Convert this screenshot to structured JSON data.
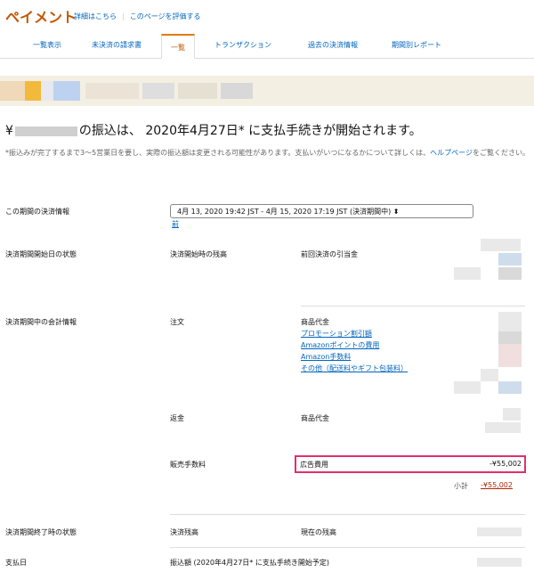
{
  "header": {
    "title": "ペイメント",
    "details_link": "詳細はこちら",
    "rate_link": "このページを評価する"
  },
  "tabs": [
    {
      "label": "一覧表示"
    },
    {
      "label": "未決済の請求書"
    },
    {
      "label": "一覧"
    },
    {
      "label": "トランザクション"
    },
    {
      "label": "過去の決済情報"
    },
    {
      "label": "期間別レポート"
    }
  ],
  "headline": {
    "prefix": "¥",
    "middle": "の振込は、 2020年4月27日* に支払手続きが開始されます。"
  },
  "note": {
    "text": "*振込みが完了するまで3〜5営業日を要し、実際の振込額は変更される可能性があります。支払いがいつになるかについて詳しくは、",
    "link": "ヘルプページ",
    "suffix": "をご覧ください。"
  },
  "settlement": {
    "label": "この期間の決済情報",
    "selected_period": "4月 13, 2020 19:42 JST - 4月 15, 2020 17:19 JST (決済期間中)",
    "prev_link": "前"
  },
  "start_state": {
    "label": "決済期間開始日の状態",
    "col1": "決済開始時の残高",
    "col2": "前回決済の引当金"
  },
  "accounting": {
    "label": "決済期間中の会計情報",
    "order_label": "注文",
    "order_items": [
      "商品代金",
      "プロモーション割引額",
      "Amazonポイントの費用",
      "Amazon手数料",
      "その他（配送料やギフト包装料）"
    ],
    "refund_label": "返金",
    "refund_item": "商品代金",
    "fee_label": "販売手数料",
    "ad_label": "広告費用",
    "ad_amount": "-¥55,002",
    "subtotal_label": "小計",
    "subtotal_amount": "-¥55,002"
  },
  "end_state": {
    "label": "決済期間終了時の状態",
    "col1": "決済残高",
    "col2": "現在の残高"
  },
  "payment_date": {
    "label": "支払日",
    "col1": "振込額 (2020年4月27日* に支払手続き開始予定)"
  }
}
